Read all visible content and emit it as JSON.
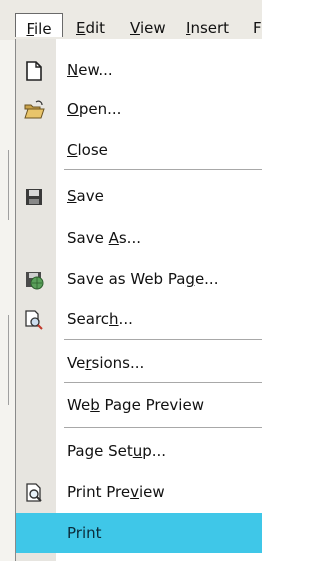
{
  "menubar": {
    "items": [
      {
        "label": "File",
        "mnemonic": "F",
        "rest": "ile"
      },
      {
        "label": "Edit",
        "mnemonic": "E",
        "rest": "dit"
      },
      {
        "label": "View",
        "mnemonic": "V",
        "rest": "iew"
      },
      {
        "label": "Insert",
        "mnemonic": "I",
        "rest": "nsert"
      },
      {
        "label": "F",
        "mnemonic": "",
        "rest": "F"
      }
    ]
  },
  "file_menu": {
    "items": {
      "new": {
        "pre": "",
        "u": "N",
        "post": "ew..."
      },
      "open": {
        "pre": "",
        "u": "O",
        "post": "pen..."
      },
      "close": {
        "pre": "",
        "u": "C",
        "post": "lose"
      },
      "save": {
        "pre": "",
        "u": "S",
        "post": "ave"
      },
      "save_as": {
        "pre": "Save ",
        "u": "A",
        "post": "s..."
      },
      "save_web": {
        "pre": "Save as Web Pa",
        "u": "g",
        "post": "e..."
      },
      "search": {
        "pre": "Searc",
        "u": "h",
        "post": "..."
      },
      "versions": {
        "pre": "Ve",
        "u": "r",
        "post": "sions..."
      },
      "web_preview": {
        "pre": "We",
        "u": "b",
        "post": " Page Preview"
      },
      "page_setup": {
        "pre": "Page Set",
        "u": "u",
        "post": "p..."
      },
      "print_preview": {
        "pre": "Print Pre",
        "u": "v",
        "post": "iew"
      },
      "print": {
        "pre": "Print",
        "u": "",
        "post": ""
      }
    },
    "highlight_color": "#3fc7e8",
    "icons": {
      "new": "new-document-icon",
      "open": "open-folder-icon",
      "save": "floppy-disk-icon",
      "save_web": "save-web-page-icon",
      "search": "search-file-icon",
      "print_preview": "print-preview-icon"
    }
  }
}
